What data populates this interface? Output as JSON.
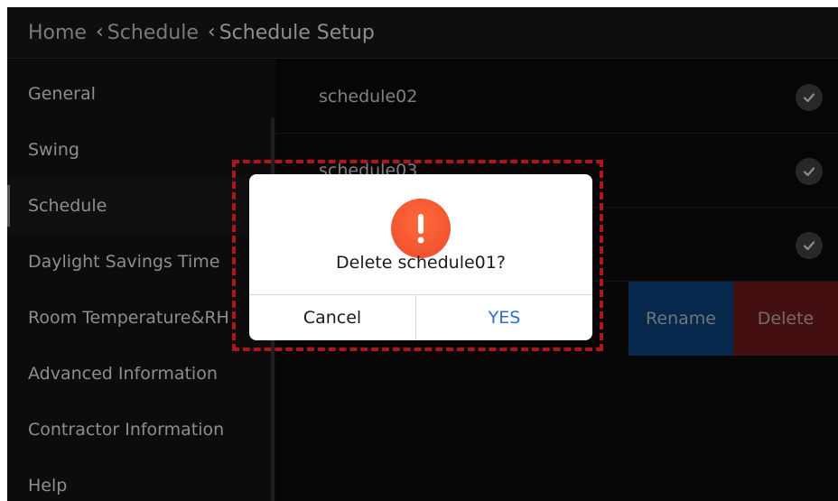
{
  "breadcrumb": {
    "home": "Home",
    "schedule": "Schedule",
    "current": "Schedule Setup"
  },
  "sidebar": {
    "items": [
      {
        "label": "General"
      },
      {
        "label": "Swing"
      },
      {
        "label": "Schedule"
      },
      {
        "label": "Daylight Savings Time"
      },
      {
        "label": "Room Temperature&RH"
      },
      {
        "label": "Advanced Information"
      },
      {
        "label": "Contractor Information"
      },
      {
        "label": "Help"
      }
    ],
    "active_index": 2
  },
  "schedules": {
    "rows": [
      {
        "name": "schedule02",
        "checked": true
      },
      {
        "name": "schedule03",
        "checked": true
      },
      {
        "name": "",
        "checked": true
      }
    ],
    "rename_label": "Rename",
    "delete_label": "Delete"
  },
  "dialog": {
    "message": "Delete schedule01?",
    "cancel_label": "Cancel",
    "yes_label": "YES",
    "icon": "alert-exclamation-icon"
  },
  "colors": {
    "accent_blue": "#2f6fd0",
    "alert_orange": "#ea4b2c",
    "rename_bg": "#0d4a8c",
    "delete_bg": "#7d1d1e",
    "highlight_red": "#b3141c"
  }
}
